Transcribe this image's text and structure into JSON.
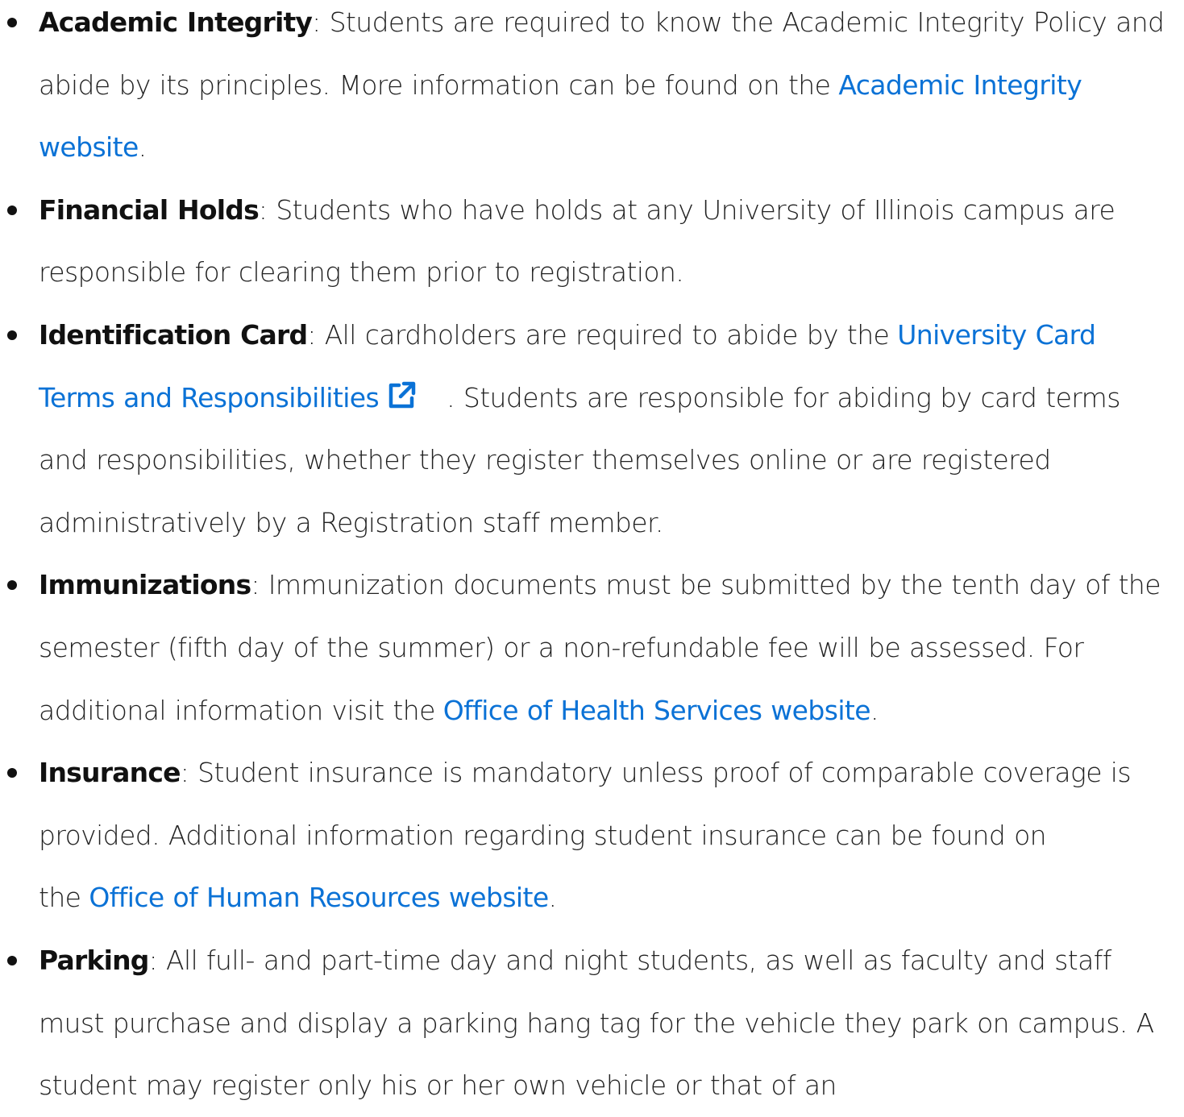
{
  "accent_color": "#0b72d6",
  "items": [
    {
      "term": "Academic Integrity",
      "text_before": ": Students are required to know the Academic Integrity Policy and abide by its principles. More information can be found on the",
      "link": "Academic Integrity website",
      "text_after": "."
    },
    {
      "term": "Financial Holds",
      "text_before": ": Students who have holds at any University of Illinois campus are responsible for clearing them prior to registration."
    },
    {
      "term": "Identification Card",
      "text_before": ": All cardholders are required to abide by the",
      "link": "University Card Terms and Responsibilities",
      "link_icon": "external-link-icon",
      "text_after": ". Students are responsible for abiding by card terms and responsibilities, whether they register themselves online or are registered administratively by a Registration staff member."
    },
    {
      "term": "Immunizations",
      "text_before": ": Immunization documents must be submitted by the tenth day of the semester (fifth day of the summer) or a non-refundable fee will be assessed. For additional information visit the",
      "link": "Office of Health Services website",
      "text_after": "."
    },
    {
      "term": "Insurance",
      "text_before": ": Student insurance is mandatory unless proof of comparable coverage is provided. Additional information regarding student insurance can be found on the",
      "link": "Office of Human Resources website",
      "text_after": "."
    },
    {
      "term": "Parking",
      "text_before": ": All full- and part-time day and night students, as well as faculty and staff must purchase and display a parking hang tag for the vehicle they park on campus. A student may register only his or her own vehicle or that of an"
    }
  ]
}
